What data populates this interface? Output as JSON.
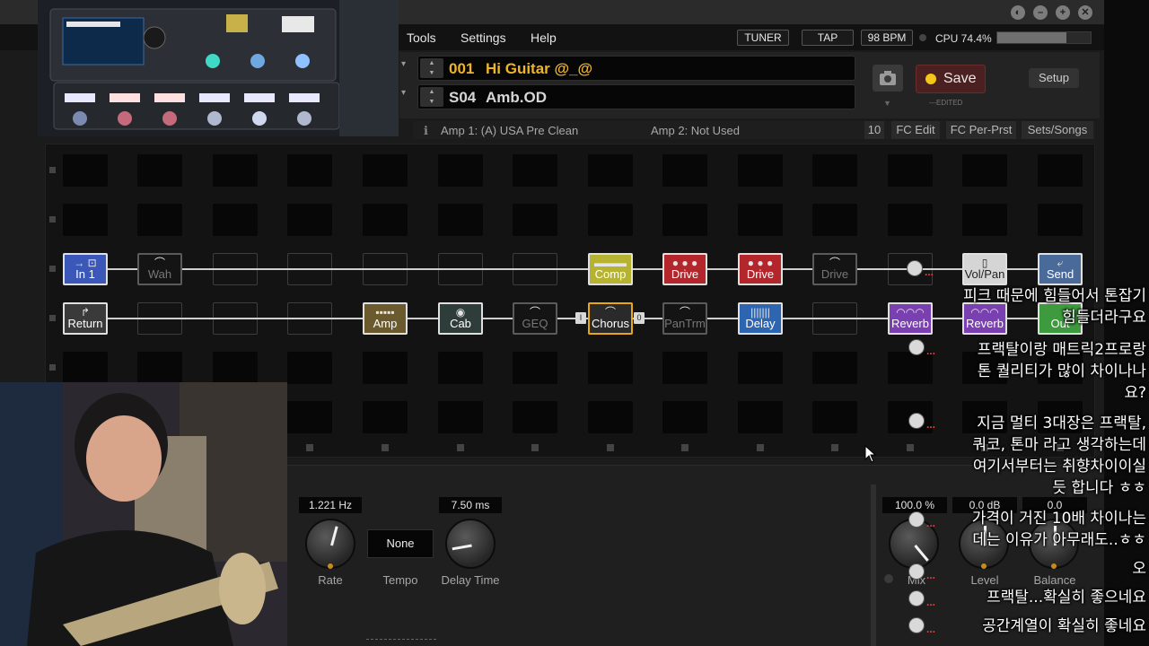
{
  "window": {
    "buttons": [
      "◐",
      "–",
      "+",
      "✕"
    ]
  },
  "menu": {
    "items": [
      "Tools",
      "Settings",
      "Help"
    ],
    "tuner": "TUNER",
    "tap": "TAP",
    "bpm": "98 BPM",
    "cpu": "CPU 74.4%",
    "cpu_percent": 74.4
  },
  "preset": {
    "number": "001",
    "name": "Hi Guitar @_@",
    "scene_number": "S04",
    "scene_name": "Amb.OD",
    "save_label": "Save",
    "edited_label": "---EDITED",
    "setup_label": "Setup"
  },
  "infobar": {
    "info_icon": "ℹ",
    "amp1": "Amp 1: (A) USA Pre Clean",
    "amp2": "Amp 2: Not Used",
    "number": "10",
    "buttons": [
      "FC Edit",
      "FC Per-Prst",
      "Sets/Songs"
    ]
  },
  "grid": {
    "row1": [
      {
        "label": "In 1",
        "art": "→ ⊡",
        "style": "in"
      },
      {
        "label": "Wah",
        "art": "⌒",
        "style": "dim"
      },
      {
        "label": "Comp",
        "art": "▬▬▬",
        "style": "comp"
      },
      {
        "label": "Drive",
        "art": "● ● ●",
        "style": "drive"
      },
      {
        "label": "Drive",
        "art": "● ● ●",
        "style": "drive"
      },
      {
        "label": "Drive",
        "art": "⌒",
        "style": "dim"
      },
      {
        "label": "Vol/Pan",
        "art": "▯",
        "style": "volpan"
      },
      {
        "label": "Send",
        "art": "⤶",
        "style": "send"
      }
    ],
    "row2": [
      {
        "label": "Return",
        "art": "↱",
        "style": "return"
      },
      {
        "label": "Amp",
        "art": "▪▪▪▪▪",
        "style": "amp"
      },
      {
        "label": "Cab",
        "art": "◉",
        "style": "cab"
      },
      {
        "label": "GEQ",
        "art": "⌒",
        "style": "dim"
      },
      {
        "label": "Chorus",
        "art": "⌒",
        "style": "chorus"
      },
      {
        "label": "PanTrm",
        "art": "⌒",
        "style": "dim"
      },
      {
        "label": "Delay",
        "art": "|||||||",
        "style": "delay"
      },
      {
        "label": "Reverb",
        "art": "◠◠◠",
        "style": "reverb"
      },
      {
        "label": "Reverb",
        "art": "◠◠◠",
        "style": "reverb"
      },
      {
        "label": "Out",
        "art": "",
        "style": "out"
      }
    ],
    "chorus_tags": [
      "I",
      "0"
    ]
  },
  "params": {
    "rate": {
      "value": "1.221 Hz",
      "label": "Rate"
    },
    "tempo": {
      "value": "None",
      "label": "Tempo"
    },
    "delay_time": {
      "value": "7.50 ms",
      "label": "Delay Time"
    },
    "mix": {
      "value": "100.0 %",
      "label": "Mix"
    },
    "level": {
      "value": "0.0 dB",
      "label": "Level"
    },
    "balance": {
      "value": "0.0",
      "label": "Balance"
    }
  },
  "chat": [
    {
      "text": "피크 때문에 힘들어서 톤잡기"
    },
    {
      "text": "힘들더라구요"
    },
    {
      "text": "프랙탈이랑 매트릭2프로랑"
    },
    {
      "text": "톤 퀄리티가 많이 차이나나"
    },
    {
      "text": "요?"
    },
    {
      "text": "지금 멀티 3대장은 프랙탈,"
    },
    {
      "text": "쿼코, 톤마 라고 생각하는데"
    },
    {
      "text": "여기서부터는 취향차이이실"
    },
    {
      "text": "듯 합니다 ㅎㅎ"
    },
    {
      "text": "가격이 거진 10배 차이나는"
    },
    {
      "text": "데는 이유가 아무래도..ㅎㅎ"
    },
    {
      "text": "오"
    },
    {
      "text": "프랙탈...확실히 좋으네요"
    },
    {
      "text": "공간계열이 확실히 좋네요"
    }
  ],
  "colors": {
    "accent": "#f5c518",
    "preset_text": "#f0b429",
    "in": "#3b58b8",
    "comp": "#b5b330",
    "drive": "#b3262c",
    "amp": "#6b5a2e",
    "cab": "#2f3d3a",
    "delay": "#2d65b0",
    "reverb": "#7a3fb0",
    "return": "#3a3a3a",
    "send": "#4a6a9a",
    "out": "#3d9a3d"
  }
}
